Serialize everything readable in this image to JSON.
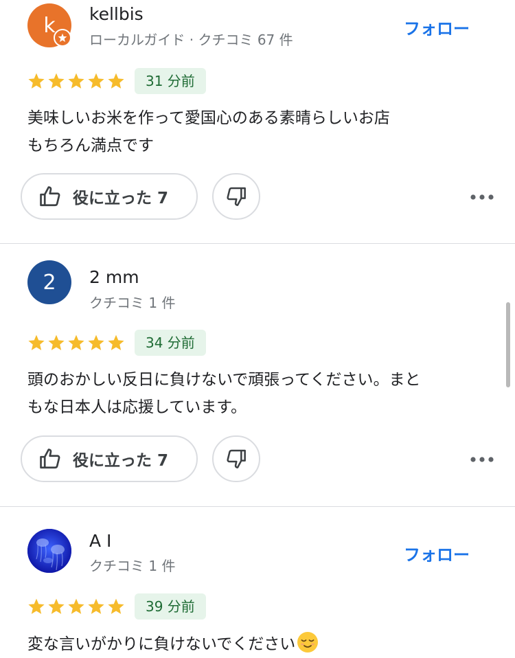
{
  "colors": {
    "accent": "#1a73e8",
    "star": "#f6bb2b",
    "badge_bg": "#e6f4ea",
    "badge_text": "#1e6b34",
    "avatar_k": "#e8732a",
    "avatar_2": "#1f4f94"
  },
  "reviews": [
    {
      "avatar_letter": "k",
      "name": "kellbis",
      "meta": "ローカルガイド · クチコミ 67 件",
      "follow_label": "フォロー",
      "rating": 5,
      "time": "31 分前",
      "text_lines": [
        "美味しいお米を作って愛国心のある素晴らしいお店",
        "もちろん満点です"
      ],
      "helpful_label": "役に立った 7"
    },
    {
      "avatar_letter": "2",
      "name": "2 mm",
      "meta": "クチコミ 1 件",
      "rating": 5,
      "time": "34 分前",
      "text_lines": [
        "頭のおかしい反日に負けないで頑張ってください。まと",
        "もな日本人は応援しています。"
      ],
      "helpful_label": "役に立った 7"
    },
    {
      "name": "A I",
      "meta": "クチコミ 1 件",
      "follow_label": "フォロー",
      "rating": 5,
      "time": "39 分前",
      "text_lines": [
        "変な言いがかりに負けないでください"
      ],
      "text_emoji": "relieved-face-emoji"
    }
  ]
}
